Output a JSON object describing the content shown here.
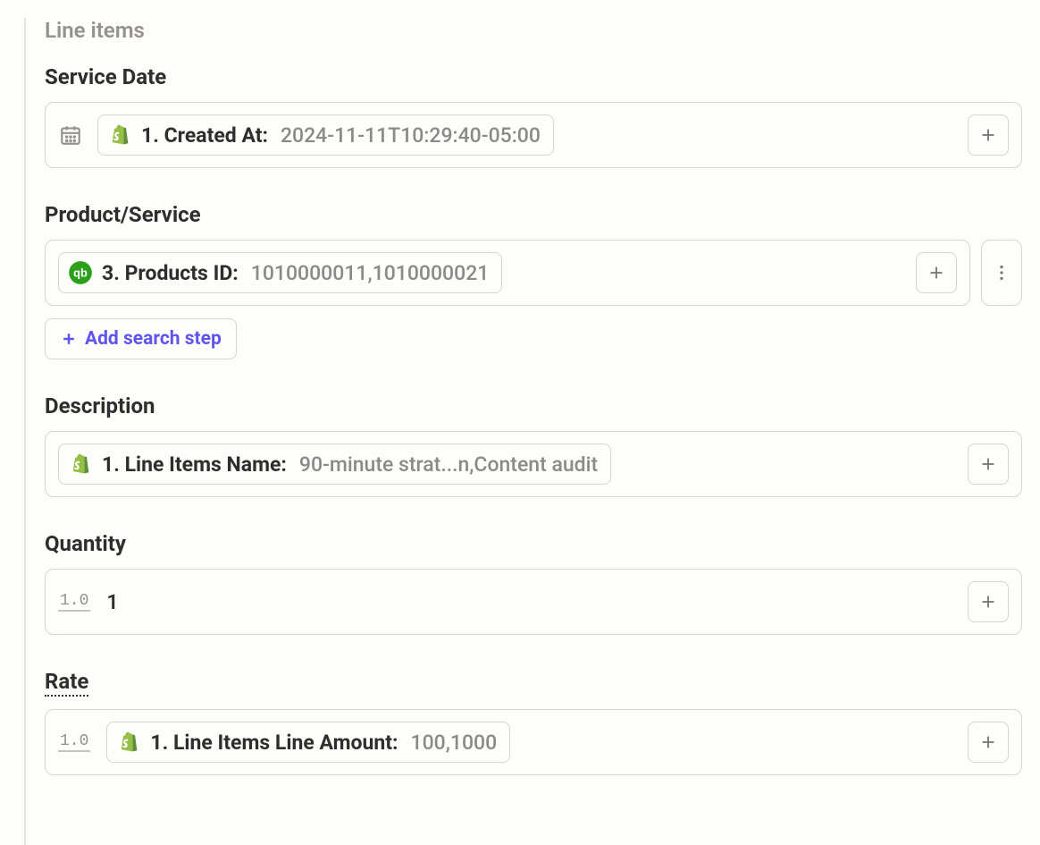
{
  "section_heading": "Line items",
  "fields": {
    "service_date": {
      "label": "Service Date",
      "pill_label": "1. Created At:",
      "pill_value": "2024-11-11T10:29:40-05:00",
      "app": "shopify"
    },
    "product_service": {
      "label": "Product/Service",
      "pill_label": "3. Products ID:",
      "pill_value": "1010000011,1010000021",
      "app": "quickbooks",
      "add_search_step_label": "Add search step"
    },
    "description": {
      "label": "Description",
      "pill_label": "1. Line Items Name:",
      "pill_value": "90-minute strat...n,Content audit",
      "app": "shopify"
    },
    "quantity": {
      "label": "Quantity",
      "numeric_hint": "1.0",
      "value": "1"
    },
    "rate": {
      "label": "Rate",
      "numeric_hint": "1.0",
      "pill_label": "1. Line Items Line Amount:",
      "pill_value": "100,1000",
      "app": "shopify"
    }
  }
}
